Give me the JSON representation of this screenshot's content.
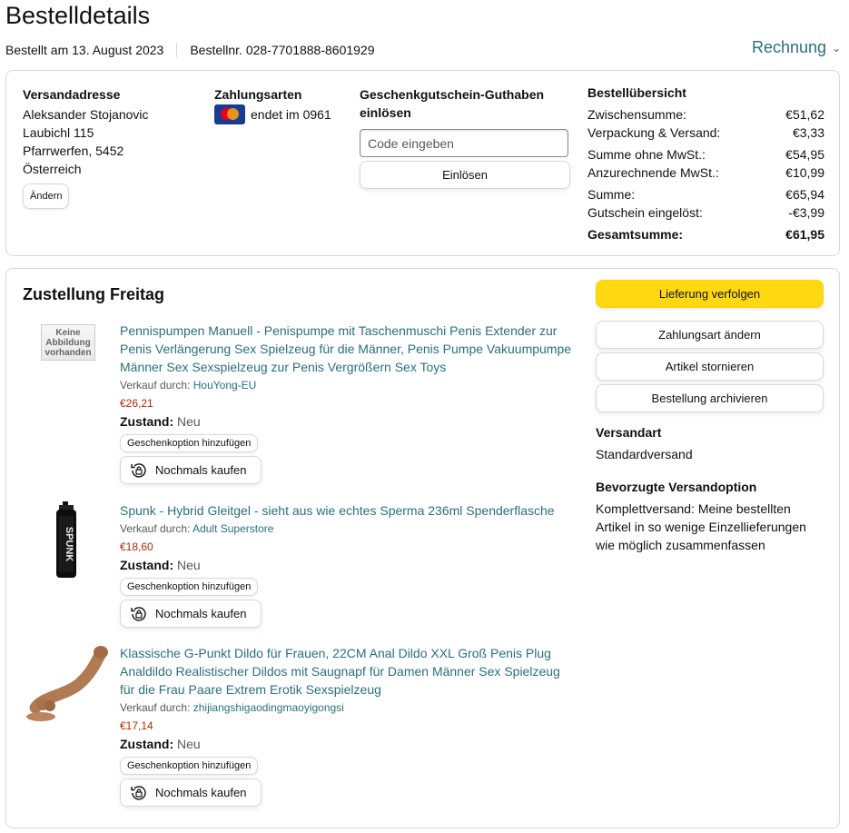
{
  "page": {
    "title": "Bestelldetails",
    "ordered_on": "Bestellt am 13. August 2023",
    "order_number": "Bestellnr. 028-7701888-8601929",
    "invoice_label": "Rechnung"
  },
  "shipping": {
    "heading": "Versandadresse",
    "lines": [
      "Aleksander Stojanovic",
      "Laubichl 115",
      "Pfarrwerfen, 5452",
      "Österreich"
    ],
    "change_label": "Ändern"
  },
  "payment": {
    "heading": "Zahlungsarten",
    "card_text": "endet im 0961",
    "card_icon": "mastercard-icon"
  },
  "gift_card": {
    "heading": "Geschenkgutschein-Guthaben einlösen",
    "placeholder": "Code eingeben",
    "redeem_label": "Einlösen"
  },
  "summary": {
    "heading": "Bestellübersicht",
    "rows": [
      {
        "label": "Zwischensumme:",
        "value": "€51,62"
      },
      {
        "label": "Verpackung & Versand:",
        "value": "€3,33"
      },
      {
        "label": "Summe ohne MwSt.:",
        "value": "€54,95"
      },
      {
        "label": "Anzurechnende MwSt.:",
        "value": "€10,99"
      },
      {
        "label": "Summe:",
        "value": "€65,94"
      },
      {
        "label": "Gutschein eingelöst:",
        "value": "-€3,99"
      },
      {
        "label": "Gesamtsumme:",
        "value": "€61,95"
      }
    ]
  },
  "delivery": {
    "title": "Zustellung Freitag",
    "track_label": "Lieferung verfolgen",
    "buttons": [
      "Zahlungsart ändern",
      "Artikel stornieren",
      "Bestellung archivieren"
    ],
    "shipping_method_heading": "Versandart",
    "shipping_method": "Standardversand",
    "preferred_heading": "Bevorzugte Versandoption",
    "preferred_text": "Komplettversand: Meine bestellten Artikel in so wenige Einzellieferungen wie möglich zusammenfassen"
  },
  "labels": {
    "sold_by": "Verkauf durch:",
    "condition": "Zustand:",
    "gift_option": "Geschenkoption hinzufügen",
    "buy_again": "Nochmals kaufen",
    "no_image": "Keine Abbildung vorhanden"
  },
  "items": [
    {
      "title": "Pennispumpen Manuell - Penispumpe mit Taschenmuschi Penis Extender zur Penis Verlängerung Sex Spielzeug für die Männer, Penis Pumpe Vakuumpumpe Männer Sex Sexspielzeug zur Penis Vergrößern Sex Toys",
      "seller": "HouYong-EU",
      "price": "€26,21",
      "condition": "Neu"
    },
    {
      "title": "Spunk - Hybrid Gleitgel - sieht aus wie echtes Sperma 236ml Spenderflasche",
      "seller": "Adult Superstore",
      "price": "€18,60",
      "condition": "Neu",
      "product_text": "SPUNK"
    },
    {
      "title": "Klassische G-Punkt Dildo für Frauen, 22CM Anal Dildo XXL Groß Penis Plug Analdildo Realistischer Dildos mit Saugnapf für Damen Männer Sex Spielzeug für die Frau Paare Extrem Erotik Sexspielzeug",
      "seller": "zhijiangshigaodingmaoyigongsi",
      "price": "€17,14",
      "condition": "Neu"
    }
  ],
  "colors": {
    "link": "#2a6f7c",
    "price": "#b12704",
    "primary_button": "#ffd814",
    "border": "#d5d9d9"
  }
}
